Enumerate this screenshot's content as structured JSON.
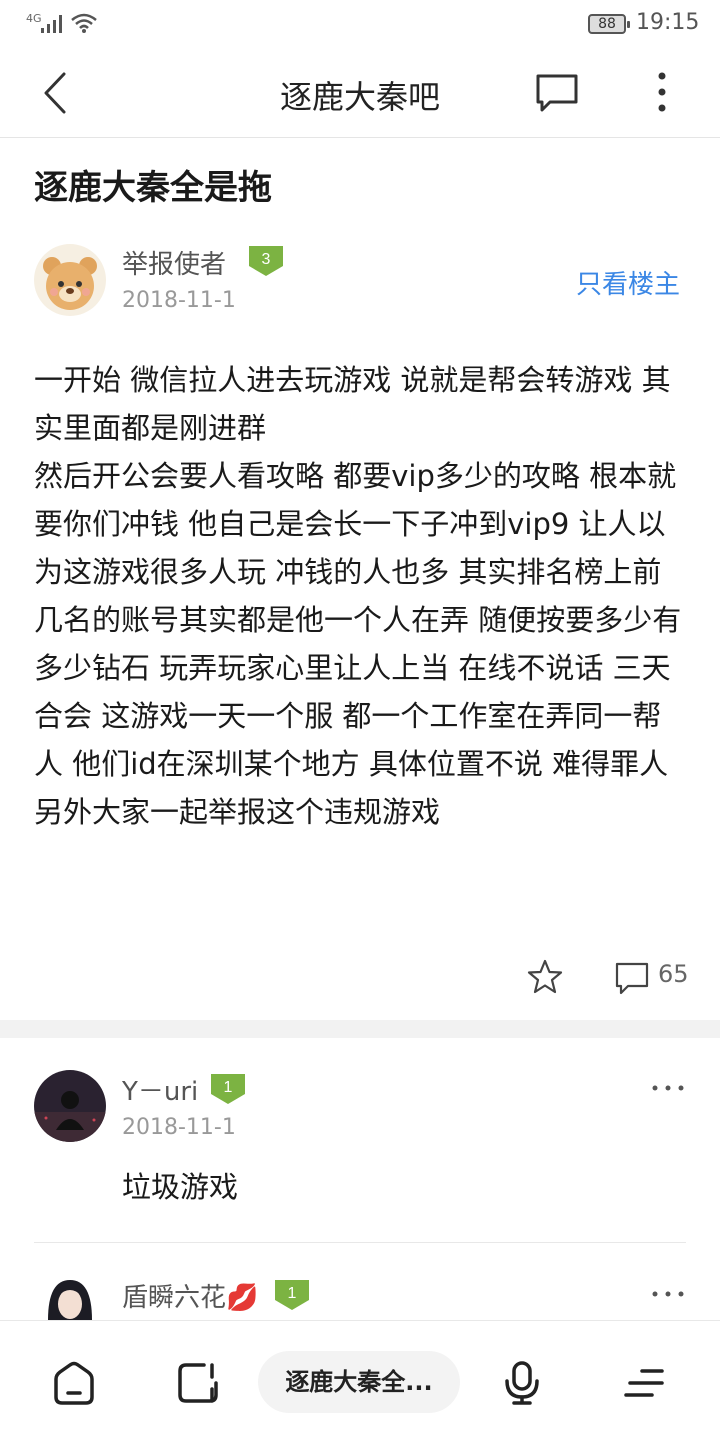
{
  "status_bar": {
    "network": "4G",
    "battery": "88",
    "time": "19:15"
  },
  "nav": {
    "title": "逐鹿大秦吧"
  },
  "post": {
    "title": "逐鹿大秦全是拖",
    "author": {
      "name": "举报使者",
      "level": "3",
      "date": "2018-11-1"
    },
    "only_op_label": "只看楼主",
    "body": [
      "一开始 微信拉人进去玩游戏 说就是帮会转游戏 其实里面都是刚进群",
      "然后开公会要人看攻略 都要vip多少的攻略 根本就要你们冲钱 他自己是会长一下子冲到vip9 让人以为这游戏很多人玩 冲钱的人也多 其实排名榜上前几名的账号其实都是他一个人在弄 随便按要多少有多少钻石 玩弄玩家心里让人上当 在线不说话 三天合会 这游戏一天一个服 都一个工作室在弄同一帮人 他们id在深圳某个地方 具体位置不说 难得罪人",
      "另外大家一起举报这个违规游戏"
    ],
    "reply_count": "65"
  },
  "replies": [
    {
      "name": "Y－uri",
      "level": "1",
      "date": "2018-11-1",
      "text": "垃圾游戏"
    },
    {
      "name": "盾瞬六花💋",
      "level": "1"
    }
  ],
  "bottom_bar": {
    "pill_label": "逐鹿大秦全..."
  },
  "colors": {
    "accent": "#3b87e5",
    "badge": "#7cb342"
  }
}
